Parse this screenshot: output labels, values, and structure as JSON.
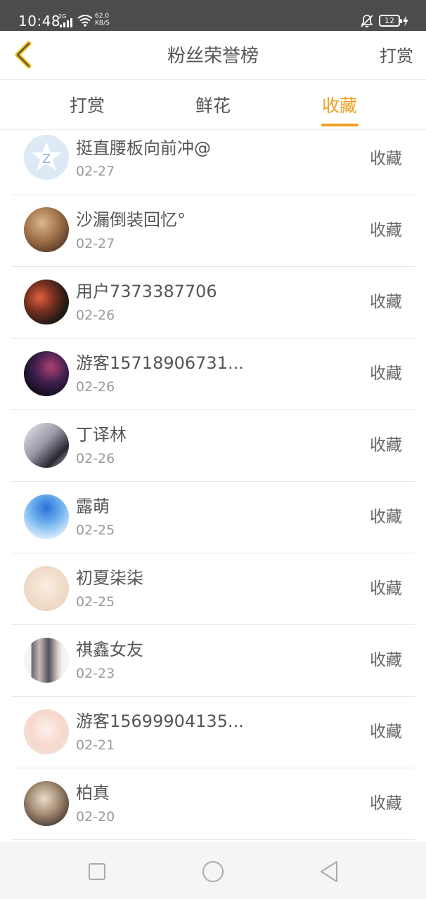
{
  "status_bar": {
    "time": "10:48",
    "network": "2G",
    "speed_value": "62.0",
    "speed_unit": "KB/S",
    "battery": "12",
    "icons": [
      "signal-icon",
      "wifi-icon",
      "mute-bell-icon",
      "battery-icon",
      "charging-bolt-icon"
    ]
  },
  "header": {
    "title": "粉丝荣誉榜",
    "action_label": "打赏",
    "back_icon": "chevron-left-icon"
  },
  "tabs": [
    {
      "label": "打赏",
      "active": false
    },
    {
      "label": "鲜花",
      "active": false
    },
    {
      "label": "收藏",
      "active": true
    }
  ],
  "colors": {
    "accent": "#f0a020",
    "text": "#555555",
    "subtext": "#9a9a9a",
    "status_bar": "#4c4c4c"
  },
  "list": [
    {
      "name": "挺直腰板向前冲@",
      "date": "02-27",
      "type": "收藏",
      "avatar": "default-z-avatar"
    },
    {
      "name": "沙漏倒装回忆°",
      "date": "02-27",
      "type": "收藏",
      "avatar": "photo-avatar"
    },
    {
      "name": "用户7373387706",
      "date": "02-26",
      "type": "收藏",
      "avatar": "photo-avatar"
    },
    {
      "name": "游客15718906731...",
      "date": "02-26",
      "type": "收藏",
      "avatar": "galaxy-avatar"
    },
    {
      "name": "丁译林",
      "date": "02-26",
      "type": "收藏",
      "avatar": "photo-avatar"
    },
    {
      "name": "露萌",
      "date": "02-25",
      "type": "收藏",
      "avatar": "anime-avatar"
    },
    {
      "name": "初夏柒柒",
      "date": "02-25",
      "type": "收藏",
      "avatar": "anime-avatar"
    },
    {
      "name": "祺鑫女友",
      "date": "02-23",
      "type": "收藏",
      "avatar": "photo-avatar"
    },
    {
      "name": "游客15699904135...",
      "date": "02-21",
      "type": "收藏",
      "avatar": "anime-avatar"
    },
    {
      "name": "柏真",
      "date": "02-20",
      "type": "收藏",
      "avatar": "photo-avatar"
    }
  ],
  "nav_bar": {
    "buttons": [
      "recents-square-icon",
      "home-circle-icon",
      "back-triangle-icon"
    ]
  }
}
